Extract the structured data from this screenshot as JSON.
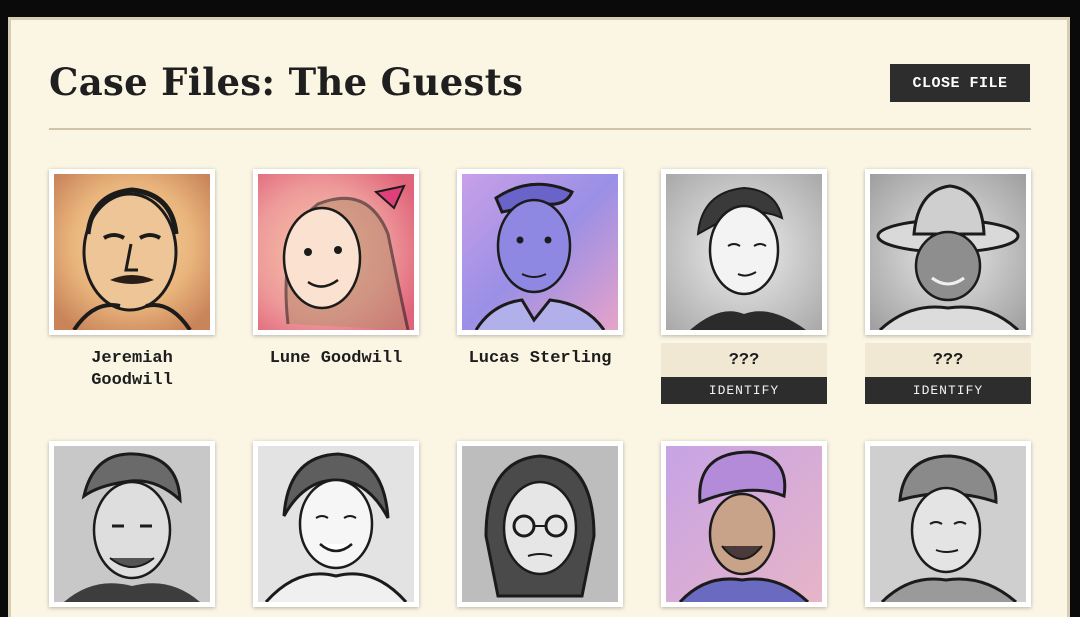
{
  "header": {
    "title": "Case Files: The Guests",
    "close_label": "CLOSE FILE"
  },
  "guests_row1": [
    {
      "name": "Jeremiah Goodwill",
      "identified": true
    },
    {
      "name": "Lune Goodwill",
      "identified": true
    },
    {
      "name": "Lucas Sterling",
      "identified": true
    },
    {
      "name": "???",
      "identified": false,
      "action_label": "IDENTIFY"
    },
    {
      "name": "???",
      "identified": false,
      "action_label": "IDENTIFY"
    }
  ],
  "colors": {
    "panel_bg": "#fbf5e4",
    "button_dark": "#2d2d2d",
    "unknown_bg": "#f0e8d3"
  }
}
